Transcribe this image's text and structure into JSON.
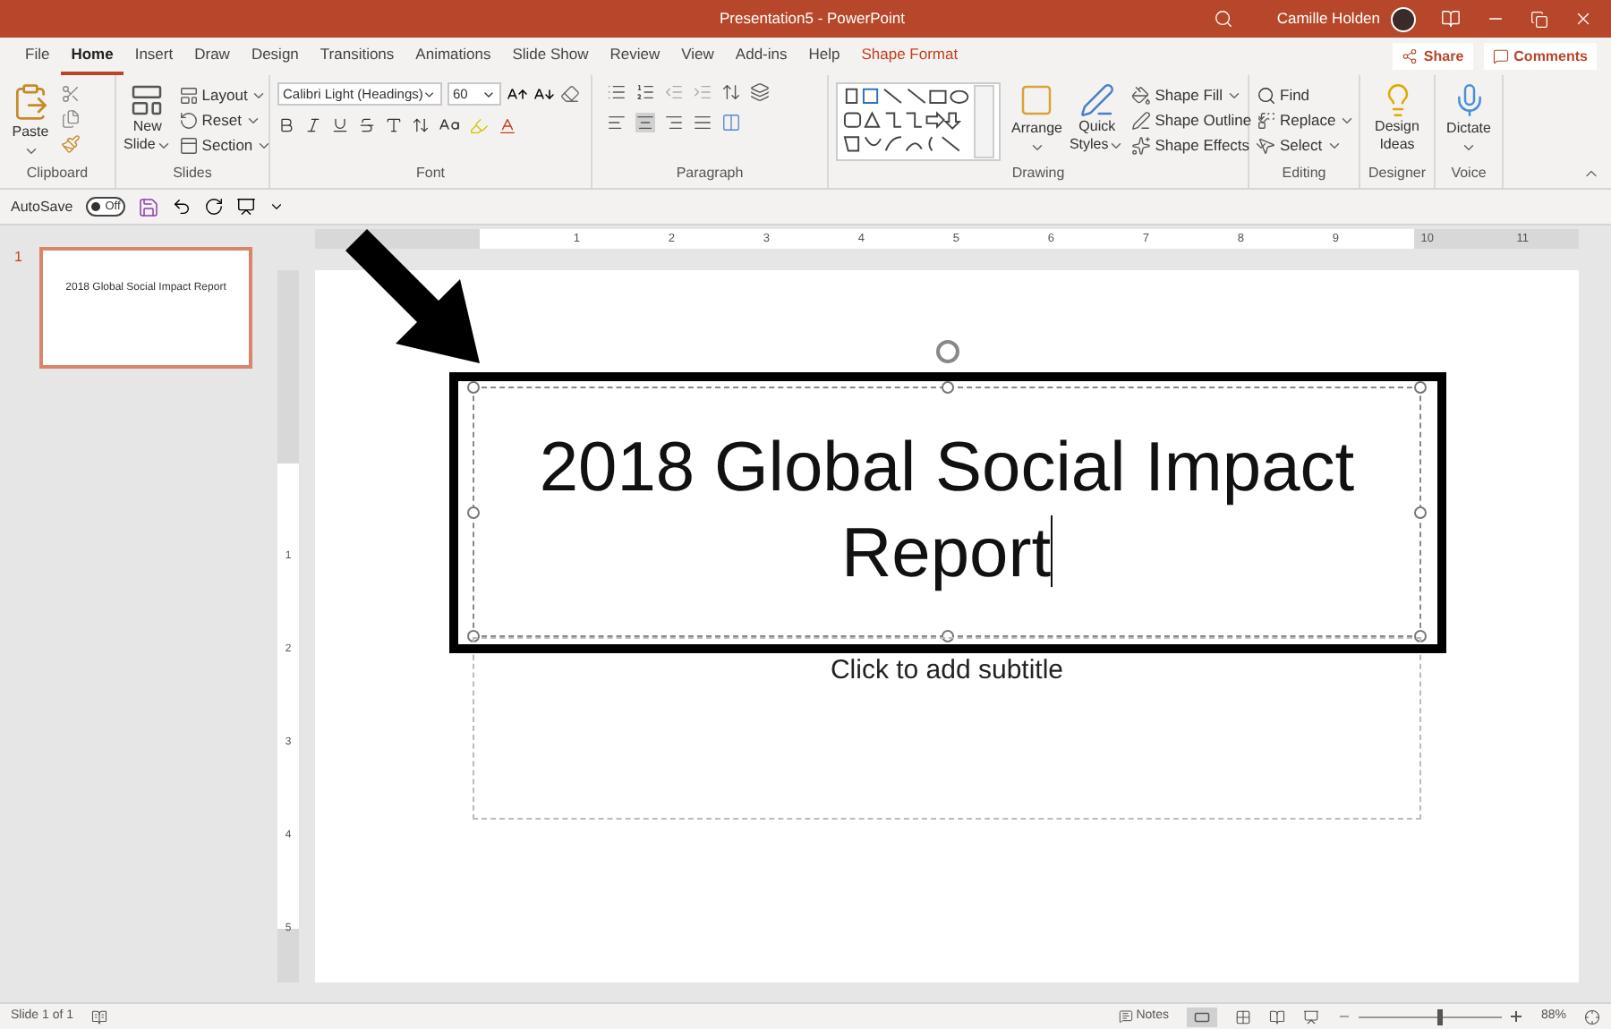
{
  "window": {
    "title": "Presentation5 - PowerPoint",
    "user": "Camille Holden"
  },
  "tabs": [
    {
      "label": "File",
      "selected": false,
      "kind": "normal"
    },
    {
      "label": "Home",
      "selected": true,
      "kind": "normal"
    },
    {
      "label": "Insert",
      "selected": false,
      "kind": "normal"
    },
    {
      "label": "Draw",
      "selected": false,
      "kind": "normal"
    },
    {
      "label": "Design",
      "selected": false,
      "kind": "normal"
    },
    {
      "label": "Transitions",
      "selected": false,
      "kind": "normal"
    },
    {
      "label": "Animations",
      "selected": false,
      "kind": "normal"
    },
    {
      "label": "Slide Show",
      "selected": false,
      "kind": "normal"
    },
    {
      "label": "Review",
      "selected": false,
      "kind": "normal"
    },
    {
      "label": "View",
      "selected": false,
      "kind": "normal"
    },
    {
      "label": "Add-ins",
      "selected": false,
      "kind": "normal"
    },
    {
      "label": "Help",
      "selected": false,
      "kind": "normal"
    },
    {
      "label": "Shape Format",
      "selected": false,
      "kind": "contextual"
    }
  ],
  "share": "Share",
  "comments": "Comments",
  "ribbon": {
    "clipboard": {
      "label": "Clipboard",
      "paste": "Paste"
    },
    "slides": {
      "label": "Slides",
      "new_slide": [
        "New",
        "Slide"
      ],
      "layout": "Layout",
      "reset": "Reset",
      "section": "Section"
    },
    "font": {
      "label": "Font",
      "font_name": "Calibri Light (Headings)",
      "font_size": "60"
    },
    "paragraph": {
      "label": "Paragraph"
    },
    "drawing": {
      "label": "Drawing",
      "arrange": "Arrange",
      "quick_styles": [
        "Quick",
        "Styles"
      ],
      "shape_fill": "Shape Fill",
      "shape_outline": "Shape Outline",
      "shape_effects": "Shape Effects"
    },
    "editing": {
      "label": "Editing",
      "find": "Find",
      "replace": "Replace",
      "select": "Select"
    },
    "designer": {
      "label": "Designer",
      "design_ideas": [
        "Design",
        "Ideas"
      ]
    },
    "voice": {
      "label": "Voice",
      "dictate": "Dictate"
    }
  },
  "quick_access": {
    "autosave": "AutoSave",
    "toggle": {
      "label": "Off",
      "on": false
    }
  },
  "thumbnails": [
    {
      "number": "1",
      "title": "2018 Global Social Impact Report",
      "selected": true
    }
  ],
  "ruler": {
    "horizontal": [
      "1",
      "2",
      "3",
      "4",
      "5",
      "6",
      "7",
      "8",
      "9",
      "10",
      "11"
    ],
    "vertical": [
      "1",
      "2",
      "3",
      "4",
      "5"
    ]
  },
  "slide": {
    "title": "2018 Global Social Impact Report",
    "title_selected": true,
    "subtitle_placeholder": "Click to add subtitle"
  },
  "status_bar": {
    "slide_count": "Slide 1 of 1",
    "notes": "Notes",
    "zoom": "88%",
    "zoom_slider": {
      "level": 0.55
    }
  }
}
